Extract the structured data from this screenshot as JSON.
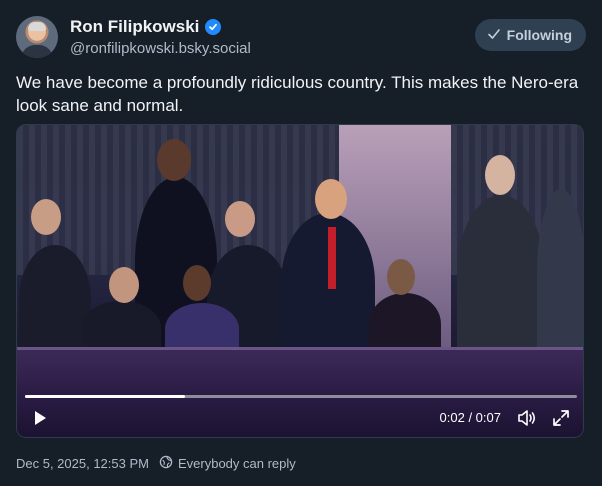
{
  "author": {
    "display_name": "Ron Filipkowski",
    "handle": "@ronfilipkowski.bsky.social",
    "verified_color": "#208bfe"
  },
  "follow_button": {
    "label": "Following",
    "icon": "check-icon"
  },
  "post": {
    "text": "We have become a profoundly ridiculous country. This makes the Nero-era look sane and normal."
  },
  "video": {
    "time": "0:02 / 0:07",
    "progress": 0.29,
    "icons": [
      "play-icon",
      "volume-icon",
      "fullscreen-icon"
    ]
  },
  "meta": {
    "timestamp": "Dec 5, 2025, 12:53 PM",
    "reply_setting": "Everybody can reply",
    "reply_icon": "globe-icon"
  },
  "colors": {
    "background": "#161e27",
    "follow_button_bg": "#2e4052",
    "muted_text": "#aebbc9"
  }
}
